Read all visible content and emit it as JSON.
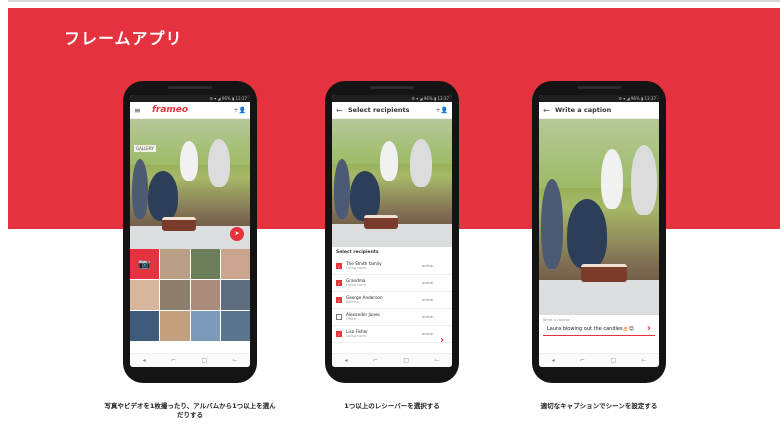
{
  "title": "フレームアプリ",
  "colors": {
    "brand": "#e5323f",
    "phone": "#141414"
  },
  "phones": [
    {
      "brand": "frameo",
      "gallery_label": "GALLERY",
      "status": "⚙ ▾ ◢ 96% ▮ 13:37"
    },
    {
      "screen_title": "Select recipients",
      "status": "⚙ ▾ ◢ 96% ▮ 13:37",
      "recipients_header": "Select recipients",
      "recipients": [
        {
          "name": "The Smith family",
          "sub": "Living room",
          "status": "online",
          "checked": true
        },
        {
          "name": "Grandma",
          "sub": "Living room",
          "status": "online",
          "checked": true
        },
        {
          "name": "George Anderson",
          "sub": "Kitchen",
          "status": "online",
          "checked": true
        },
        {
          "name": "Alexander Jones",
          "sub": "Office",
          "status": "online",
          "checked": false
        },
        {
          "name": "Lisa Fisher",
          "sub": "Living room",
          "status": "online",
          "checked": true
        }
      ]
    },
    {
      "screen_title": "Write a caption",
      "status": "⚙ ▾ ◢ 96% ▮ 13:37",
      "caption_label": "Write a caption",
      "caption_text": "Laura blowing out the candles🎂😊"
    }
  ],
  "captions": [
    "写真やビデオを1枚撮ったり、アルバムから1つ以上を選んだりする",
    "1つ以上のレシーバーを選択する",
    "適切なキャプションでシーンを設定する"
  ],
  "icons": {
    "menu": "≡",
    "add_user": "+👤",
    "back": "←",
    "send": "➤",
    "camera": "📷",
    "nav_back": "◂",
    "nav_recent": "⌐",
    "nav_home": "□",
    "nav_menu": "⇽"
  }
}
